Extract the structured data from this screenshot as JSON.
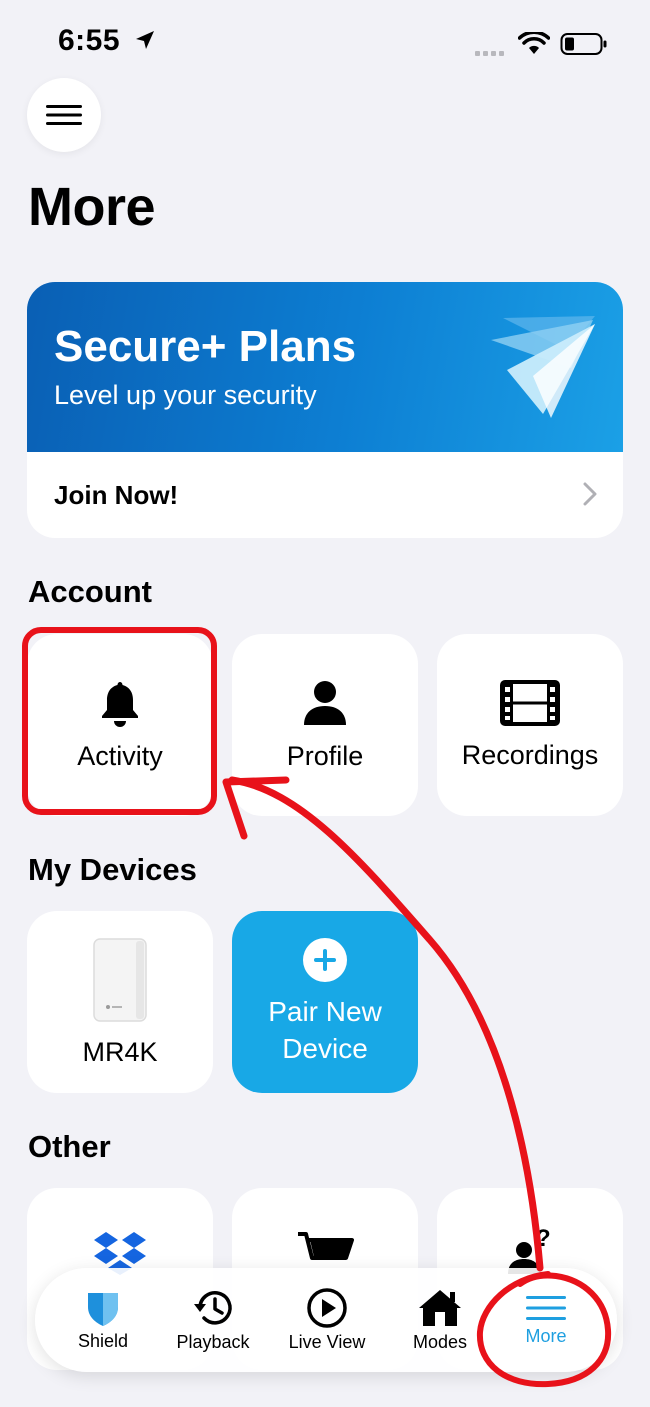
{
  "status_bar": {
    "time": "6:55"
  },
  "page": {
    "title": "More"
  },
  "promo": {
    "title": "Secure+ Plans",
    "subtitle": "Level up your security",
    "cta": "Join Now!"
  },
  "sections": {
    "account": {
      "title": "Account",
      "tiles": [
        {
          "label": "Activity",
          "icon": "bell-icon"
        },
        {
          "label": "Profile",
          "icon": "person-icon"
        },
        {
          "label": "Recordings",
          "icon": "film-icon"
        }
      ]
    },
    "devices": {
      "title": "My Devices",
      "device": {
        "label": "MR4K",
        "icon": "router-icon"
      },
      "pair": {
        "label_line1": "Pair New",
        "label_line2": "Device",
        "icon": "plus-circle-icon"
      }
    },
    "other": {
      "title": "Other",
      "tiles": [
        {
          "icon": "dropbox-icon"
        },
        {
          "icon": "cart-icon"
        },
        {
          "icon": "help-person-icon"
        }
      ]
    }
  },
  "tabbar": {
    "tabs": [
      {
        "label": "Shield",
        "icon": "shield-icon"
      },
      {
        "label": "Playback",
        "icon": "history-icon"
      },
      {
        "label": "Live View",
        "icon": "play-circle-icon"
      },
      {
        "label": "Modes",
        "icon": "home-icon"
      },
      {
        "label": "More",
        "icon": "menu-icon"
      }
    ],
    "active": "More"
  },
  "colors": {
    "accent": "#18a8e6",
    "promo_blue": "#0d7fd3",
    "annotation_red": "#e8121a",
    "background": "#f2f2f7"
  }
}
